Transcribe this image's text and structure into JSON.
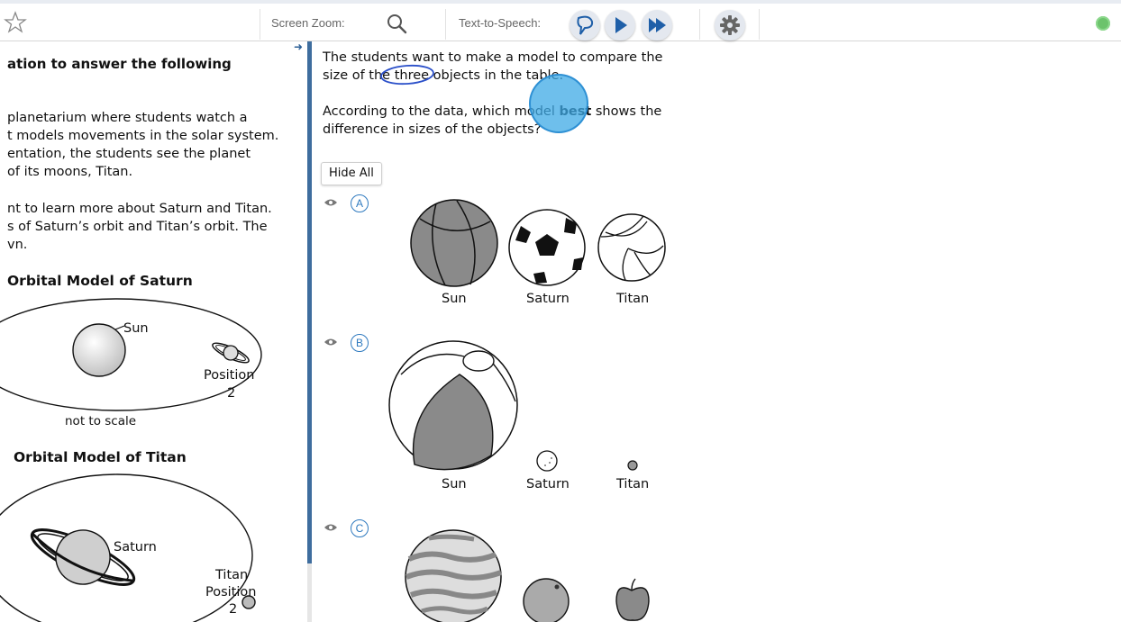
{
  "toolbar": {
    "screen_zoom_label": "Screen Zoom:",
    "tts_label": "Text-to-Speech:"
  },
  "left": {
    "heading": "ation to answer the following",
    "para1": [
      "planetarium where students watch a",
      "t models movements in the solar system.",
      "entation, the students see the planet",
      "of its moons, Titan."
    ],
    "para2": [
      "nt to learn more about Saturn and Titan.",
      "s of Saturn’s orbit and Titan’s orbit. The",
      "vn."
    ],
    "model1_title": "Orbital Model of Saturn",
    "model1_sun": "Sun",
    "model1_position": "Position",
    "model1_position_num": "2",
    "model1_note": "not to scale",
    "model2_title": "Orbital Model of Titan",
    "model2_saturn": "Saturn",
    "model2_titan": "Titan",
    "model2_position": "Position",
    "model2_position_num": "2"
  },
  "question": {
    "line1": "The students want to make a model to compare the",
    "line2": "size of the three objects in the table.",
    "line3_pre": "According to the data, which model ",
    "line3_bold": "best",
    "line3_post": " shows the",
    "line4": "difference in sizes of the objects?",
    "hide_all": "Hide All"
  },
  "options": [
    {
      "letter": "A",
      "labels": [
        "Sun",
        "Saturn",
        "Titan"
      ]
    },
    {
      "letter": "B",
      "labels": [
        "Sun",
        "Saturn",
        "Titan"
      ]
    },
    {
      "letter": "C",
      "labels": []
    }
  ],
  "colors": {
    "accent": "#2f7abf",
    "divider": "#3e6d9e",
    "status": "#6cc36c",
    "cursor": "#3eaae6"
  }
}
